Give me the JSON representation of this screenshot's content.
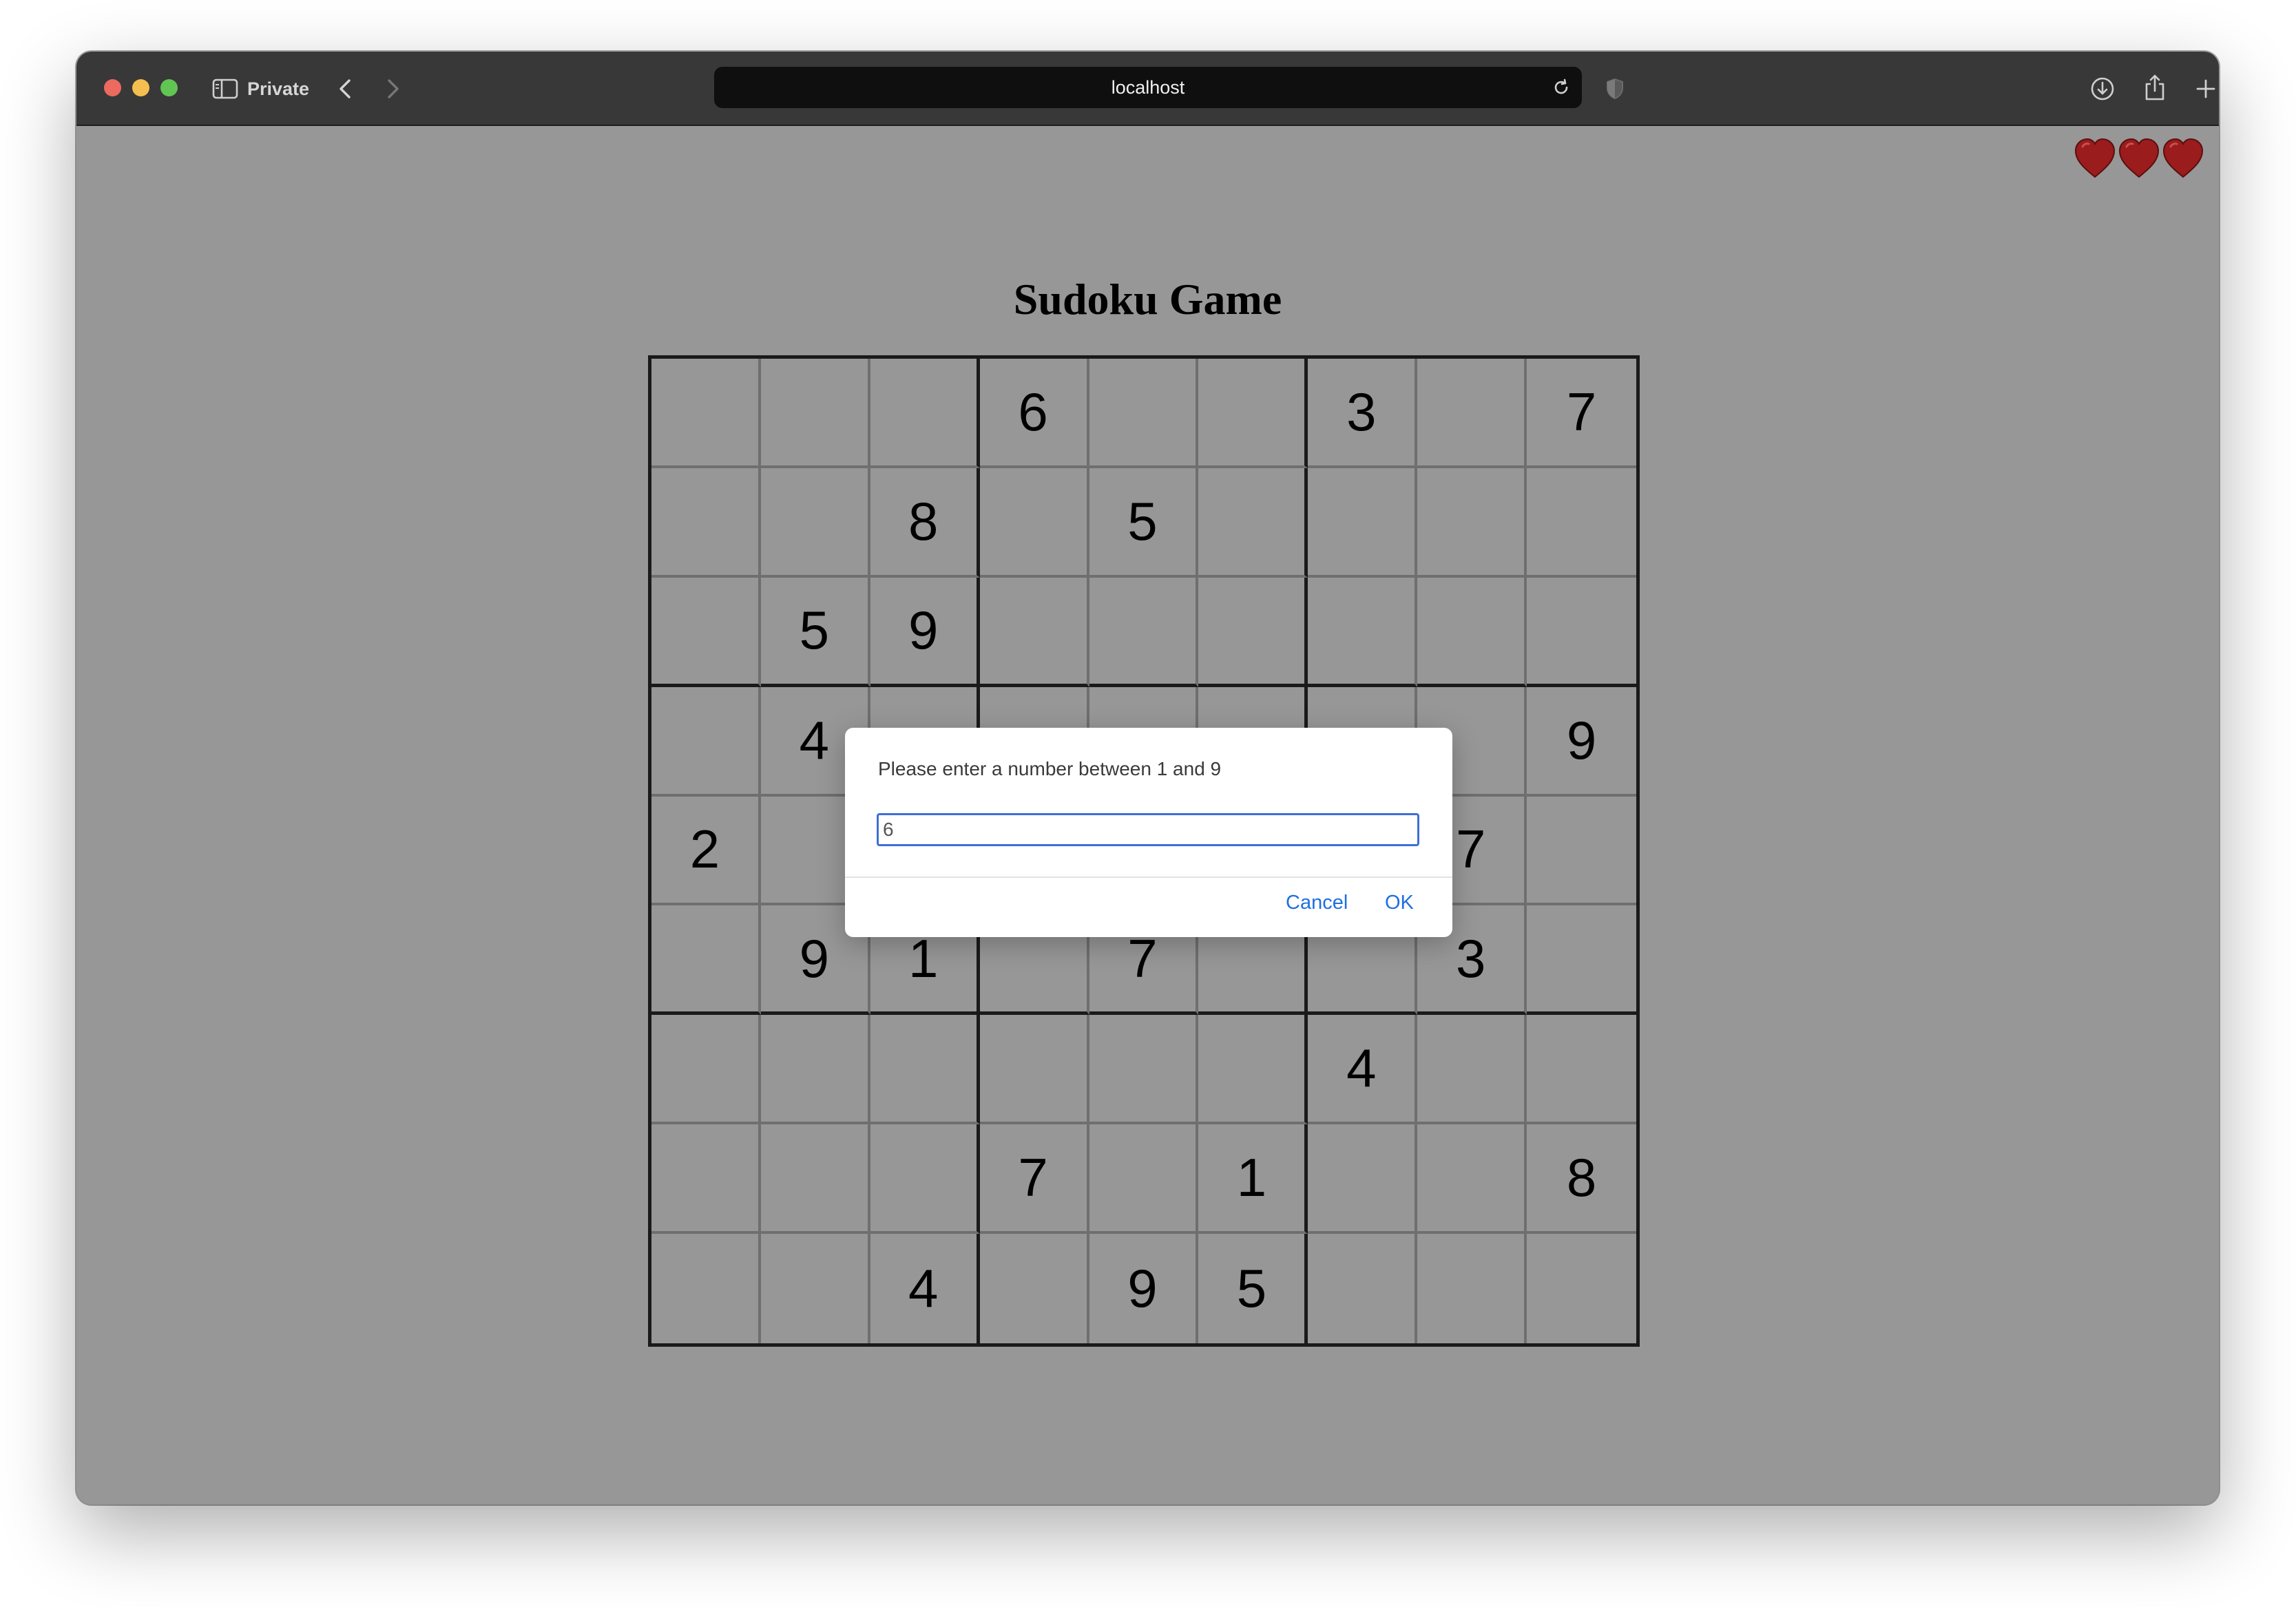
{
  "browser": {
    "mode_label": "Private",
    "url": "localhost"
  },
  "game": {
    "title": "Sudoku Game",
    "lives": 3,
    "hearts": [
      "heart-icon",
      "heart-icon",
      "heart-icon"
    ],
    "board": [
      [
        "",
        "",
        "",
        "6",
        "",
        "",
        "3",
        "",
        "7"
      ],
      [
        "",
        "",
        "8",
        "",
        "5",
        "",
        "",
        "",
        ""
      ],
      [
        "",
        "5",
        "9",
        "",
        "",
        "",
        "",
        "",
        ""
      ],
      [
        "",
        "4",
        "",
        "",
        "",
        "",
        "",
        "",
        "9"
      ],
      [
        "2",
        "",
        "",
        "",
        "",
        "",
        "",
        "7",
        ""
      ],
      [
        "",
        "9",
        "1",
        "",
        "7",
        "",
        "",
        "3",
        ""
      ],
      [
        "",
        "",
        "",
        "",
        "",
        "",
        "4",
        "",
        ""
      ],
      [
        "",
        "",
        "",
        "7",
        "",
        "1",
        "",
        "",
        "8"
      ],
      [
        "",
        "",
        "4",
        "",
        "9",
        "5",
        "",
        "",
        ""
      ]
    ]
  },
  "dialog": {
    "message": "Please enter a number between 1 and 9",
    "input_value": "6",
    "cancel_label": "Cancel",
    "ok_label": "OK"
  },
  "colors": {
    "page_background": "#979797",
    "heart": "#9b1c1c",
    "dialog_button": "#1f6fe0"
  }
}
